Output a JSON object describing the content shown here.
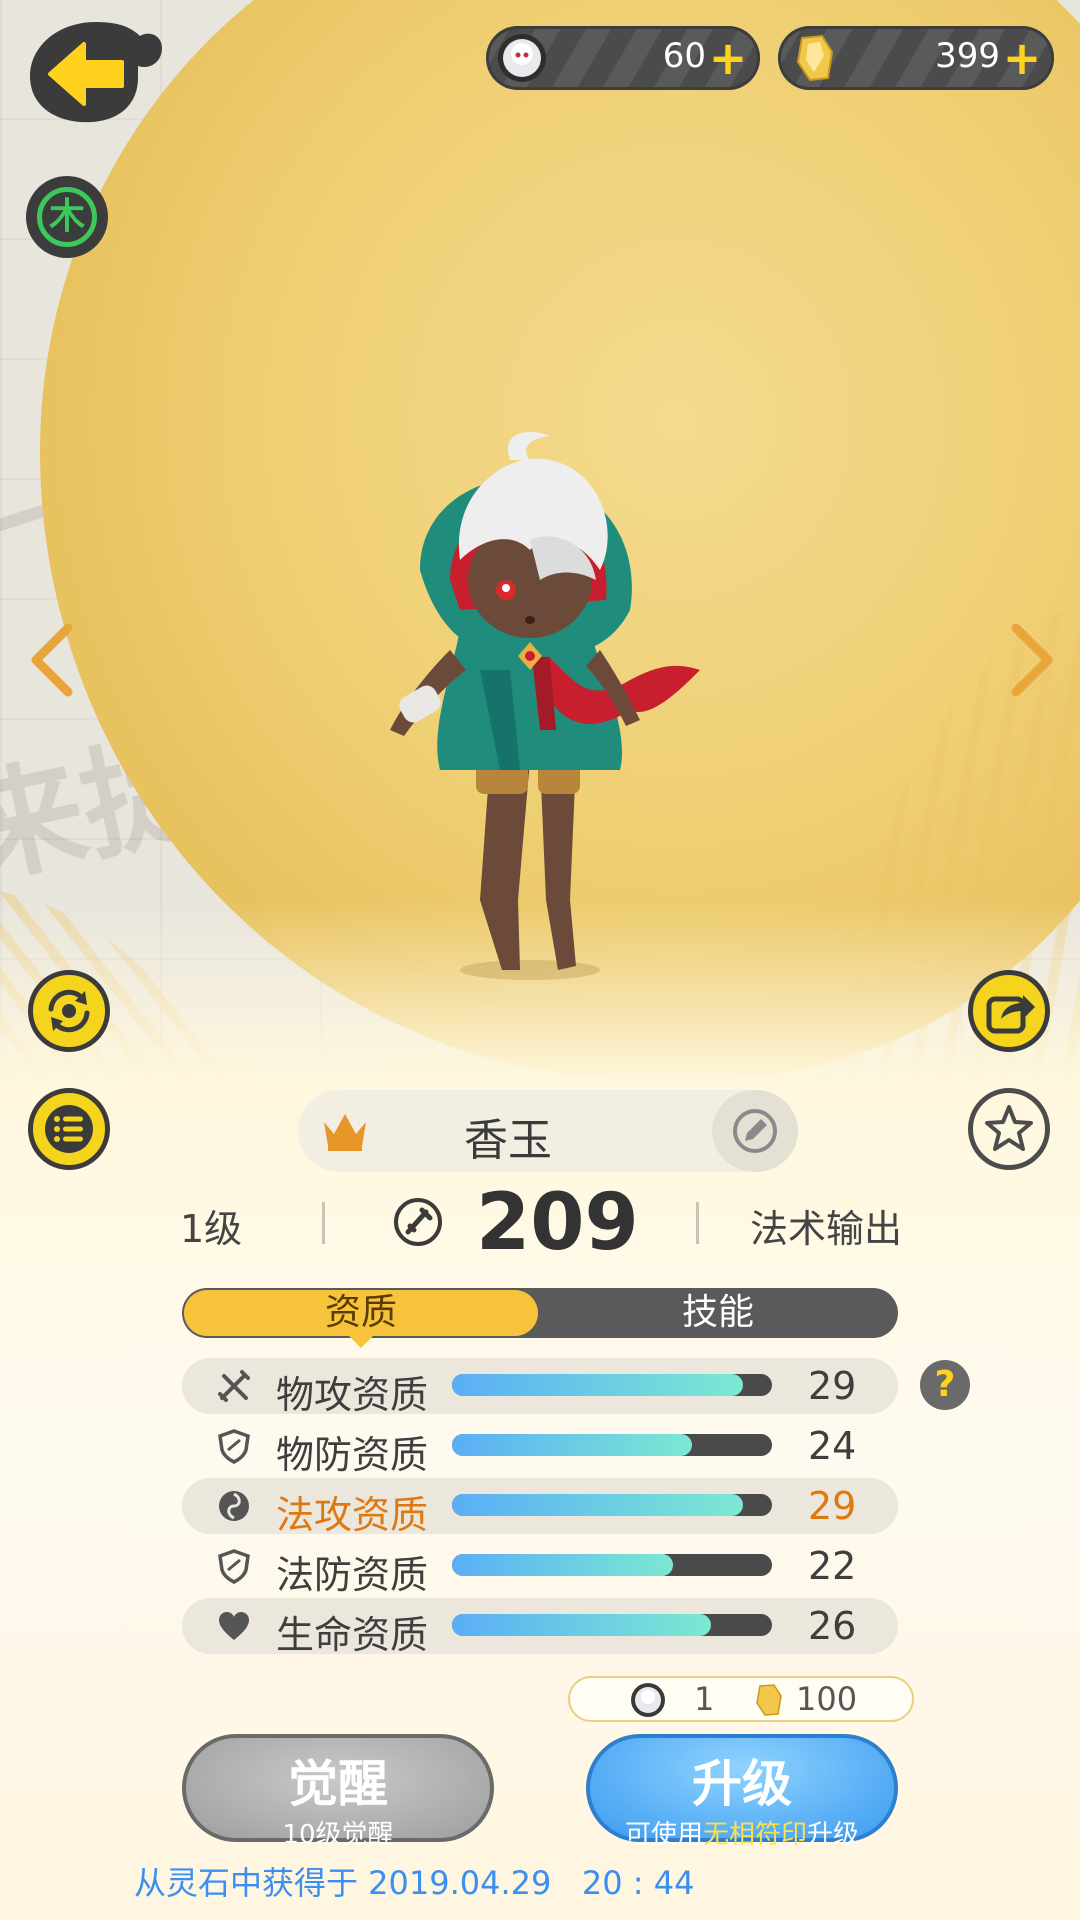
{
  "currency": {
    "spirit_count": "60",
    "crystal_count": "399",
    "plus": "+"
  },
  "element": {
    "label": "木"
  },
  "character": {
    "name": "香玉",
    "level": "1级",
    "power": "209",
    "role": "法术输出"
  },
  "tabs": {
    "aptitude": "资质",
    "skills": "技能"
  },
  "attributes": [
    {
      "name": "物攻资质",
      "value": "29",
      "fill": 0.91,
      "icon": "sword-icon",
      "highlight": false
    },
    {
      "name": "物防资质",
      "value": "24",
      "fill": 0.75,
      "icon": "shield-icon",
      "highlight": false
    },
    {
      "name": "法攻资质",
      "value": "29",
      "fill": 0.91,
      "icon": "swirl-icon",
      "highlight": true
    },
    {
      "name": "法防资质",
      "value": "22",
      "fill": 0.69,
      "icon": "shield-icon",
      "highlight": false
    },
    {
      "name": "生命资质",
      "value": "26",
      "fill": 0.81,
      "icon": "heart-icon",
      "highlight": false
    }
  ],
  "help": "?",
  "cost": {
    "spirit": "1",
    "crystal": "100"
  },
  "buttons": {
    "awaken_main": "觉醒",
    "awaken_sub": "10级觉醒",
    "upgrade_main": "升级",
    "upgrade_sub_pre": "可使用",
    "upgrade_sub_hl": "无相符印",
    "upgrade_sub_post": "升级"
  },
  "obtained": "从灵石中获得于 2019.04.29   20 : 44",
  "colors": {
    "accent_yellow": "#f5d41e",
    "tab_active": "#f6c33a",
    "highlight_orange": "#e07810",
    "upgrade_blue": "#3c9cf0",
    "element_green": "#3cc85a"
  }
}
